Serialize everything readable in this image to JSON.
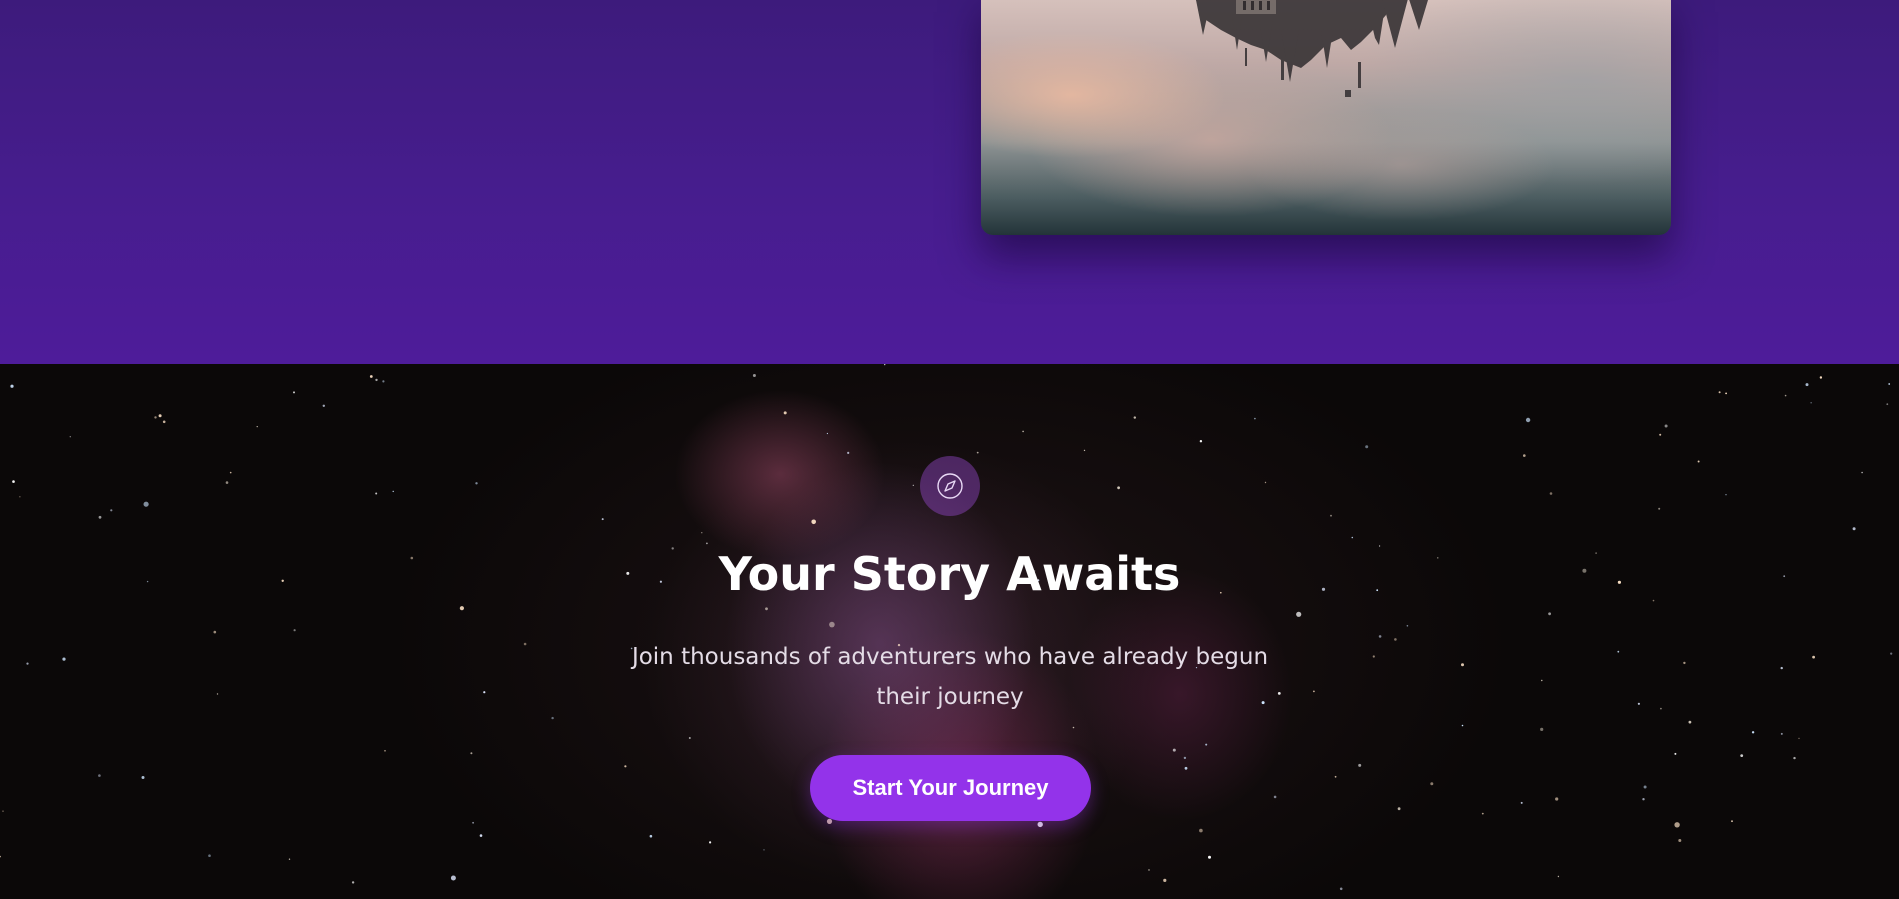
{
  "icons": {
    "cta_badge": "compass-icon"
  },
  "cta": {
    "title": "Your Story Awaits",
    "subtitle": "Join thousands of adventurers who have already begun their journey",
    "button_label": "Start Your Journey"
  },
  "colors": {
    "top_section_bg": "#461d8d",
    "button_bg": "#9333ea",
    "badge_bg": "#6a2fa0",
    "space_bg": "#0b0808"
  }
}
